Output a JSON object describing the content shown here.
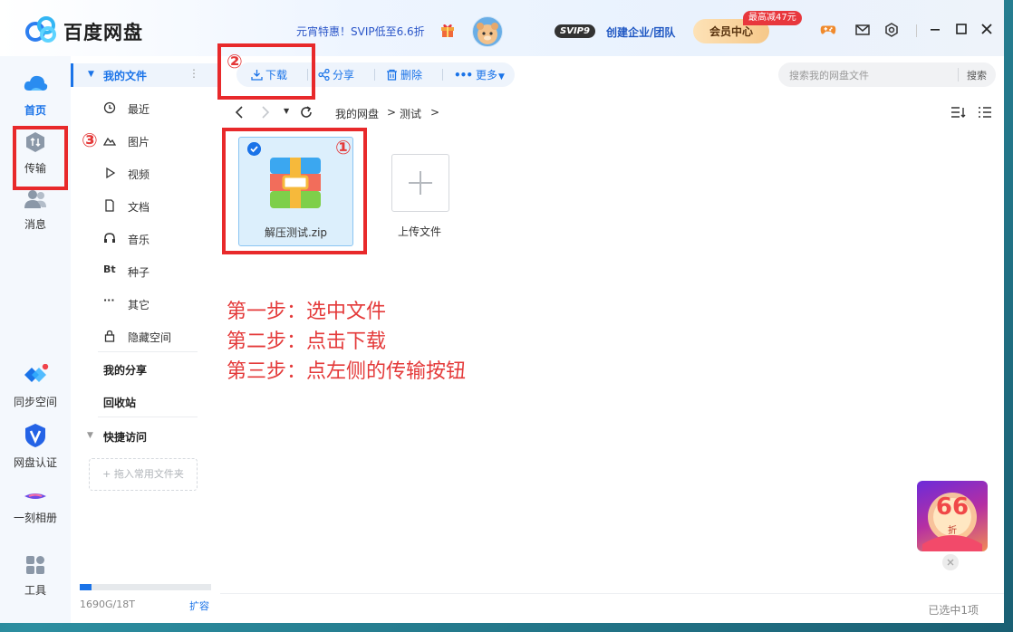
{
  "window": {
    "app_title": "百度网盘",
    "promo_text": "元宵特惠！SVIP低至6.6折",
    "svip_level": "SVIP9",
    "enterprise_link": "创建企业/团队",
    "vip_center": "会员中心",
    "discount_tag": "最高减47元"
  },
  "left_nav": {
    "items": [
      {
        "label": "首页",
        "icon": "cloud-home-icon",
        "active": true
      },
      {
        "label": "传输",
        "icon": "transfer-icon"
      },
      {
        "label": "消息",
        "icon": "message-icon"
      },
      {
        "label": "同步空间",
        "icon": "sync-space-icon"
      },
      {
        "label": "网盘认证",
        "icon": "verify-icon"
      },
      {
        "label": "一刻相册",
        "icon": "album-icon"
      },
      {
        "label": "工具",
        "icon": "tools-icon"
      }
    ]
  },
  "sidebar": {
    "header": "我的文件",
    "items": [
      {
        "label": "最近",
        "icon": "clock-icon"
      },
      {
        "label": "图片",
        "icon": "image-icon"
      },
      {
        "label": "视频",
        "icon": "video-icon"
      },
      {
        "label": "文档",
        "icon": "document-icon"
      },
      {
        "label": "音乐",
        "icon": "headphones-icon"
      },
      {
        "label": "种子",
        "icon": "bt-icon",
        "glyph": "Bt"
      },
      {
        "label": "其它",
        "icon": "more-icon",
        "glyph": "···"
      },
      {
        "label": "隐藏空间",
        "icon": "lock-icon"
      }
    ],
    "my_share": "我的分享",
    "recycle_bin": "回收站",
    "quick_access": "快捷访问",
    "quick_access_drop": "+ 拖入常用文件夹",
    "storage_text": "1690G/18T",
    "storage_used_fraction": 0.092,
    "expand": "扩容"
  },
  "toolbar": {
    "download": "下载",
    "share": "分享",
    "delete": "删除",
    "more": "更多"
  },
  "search": {
    "placeholder": "搜索我的网盘文件",
    "button": "搜索"
  },
  "breadcrumb": [
    "我的网盘",
    "测试"
  ],
  "files": {
    "selected_name": "解压测试.zip",
    "upload_label": "上传文件"
  },
  "annotations": {
    "marker_1": "①",
    "marker_2": "②",
    "marker_3": "③",
    "steps": [
      "第一步：选中文件",
      "第二步：点击下载",
      "第三步：点左侧的传输按钮"
    ]
  },
  "status": {
    "selected_count": "已选中1项"
  },
  "promo_badge": {
    "value": "66",
    "suffix": "折"
  },
  "colors": {
    "accent": "#1a73e8",
    "annotation_red": "#e8292b"
  }
}
